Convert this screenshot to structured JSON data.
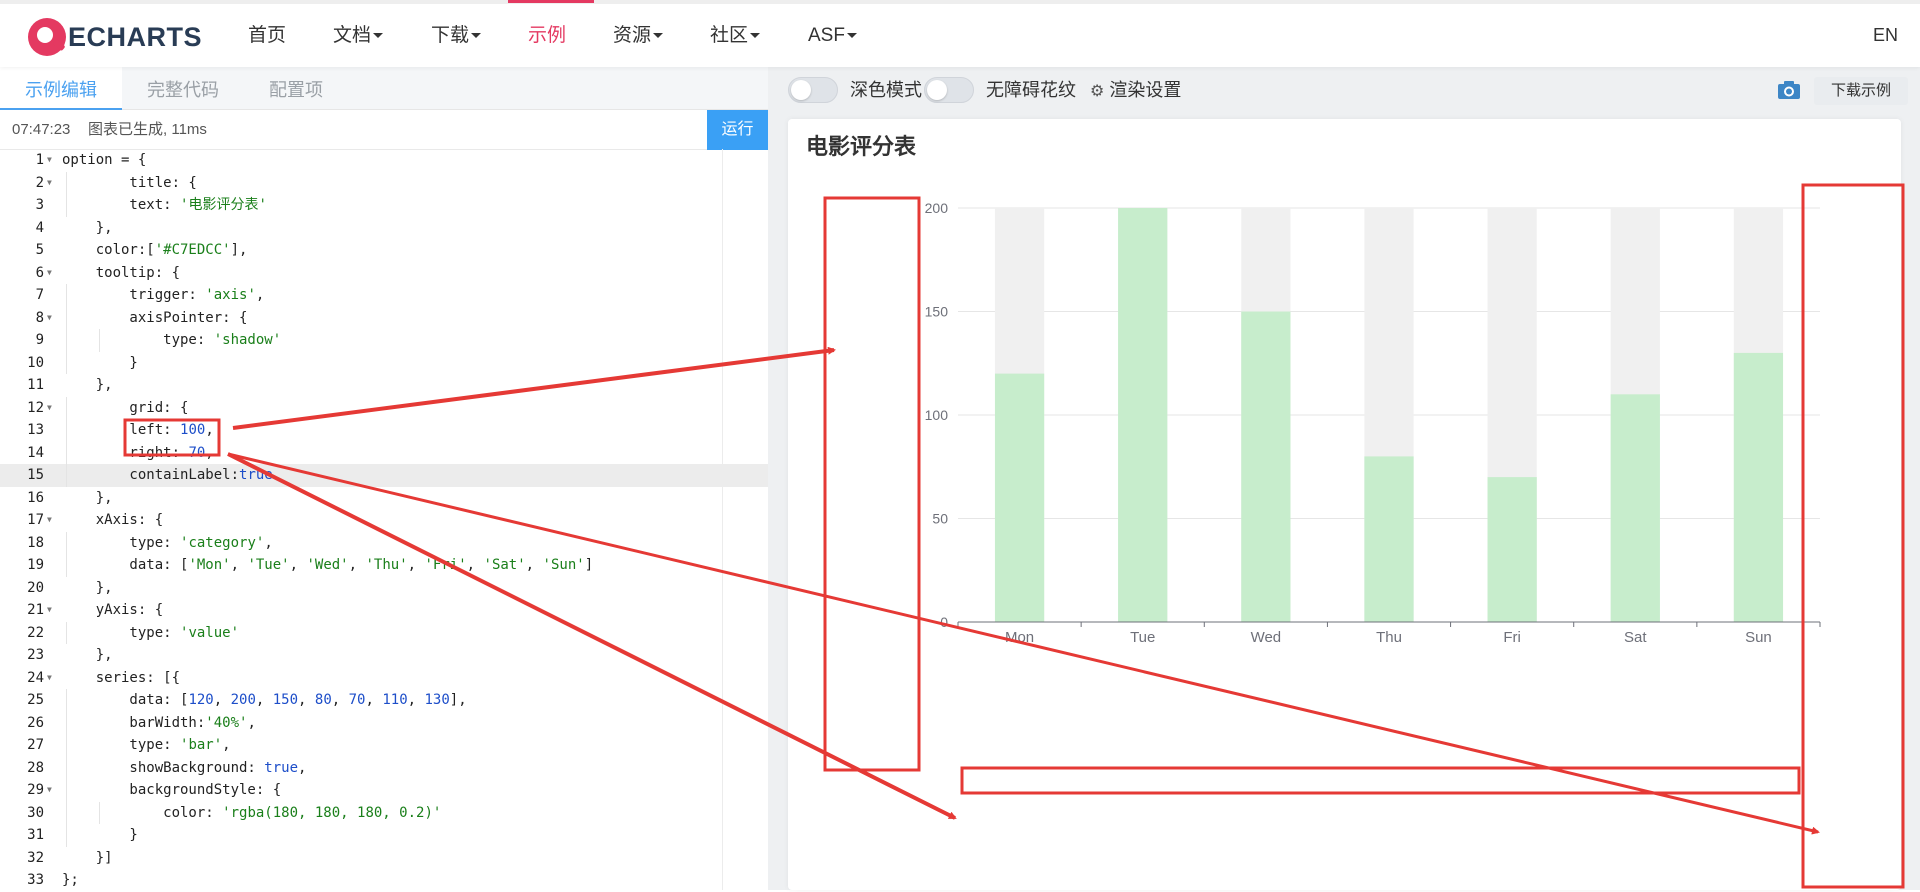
{
  "nav": {
    "logo_text": "ECHARTS",
    "items": [
      {
        "label": "首页",
        "has_caret": false,
        "active": false
      },
      {
        "label": "文档",
        "has_caret": true,
        "active": false
      },
      {
        "label": "下载",
        "has_caret": true,
        "active": false
      },
      {
        "label": "示例",
        "has_caret": false,
        "active": true
      },
      {
        "label": "资源",
        "has_caret": true,
        "active": false
      },
      {
        "label": "社区",
        "has_caret": true,
        "active": false
      },
      {
        "label": "ASF",
        "has_caret": true,
        "active": false
      }
    ],
    "lang": "EN",
    "accent_color": "#e43961"
  },
  "editor": {
    "tabs": [
      {
        "label": "示例编辑",
        "active": true
      },
      {
        "label": "完整代码",
        "active": false
      },
      {
        "label": "配置项",
        "active": false
      }
    ],
    "status_time": "07:47:23",
    "status_msg": "图表已生成, 11ms",
    "run_label": "运行",
    "code_lines": [
      "option = {",
      "        title: {",
      "        text: '电影评分表'",
      "    },",
      "    color:['#C7EDCC'],",
      "    tooltip: {",
      "        trigger: 'axis',",
      "        axisPointer: {",
      "            type: 'shadow'",
      "        }",
      "    },",
      "        grid: {",
      "        left: 100,",
      "        right: 70,",
      "        containLabel:true",
      "    },",
      "    xAxis: {",
      "        type: 'category',",
      "        data: ['Mon', 'Tue', 'Wed', 'Thu', 'Fri', 'Sat', 'Sun']",
      "    },",
      "    yAxis: {",
      "        type: 'value'",
      "    },",
      "    series: [{",
      "        data: [120, 200, 150, 80, 70, 110, 130],",
      "        barWidth:'40%',",
      "        type: 'bar',",
      "        showBackground: true,",
      "        backgroundStyle: {",
      "            color: 'rgba(180, 180, 180, 0.2)'",
      "        }",
      "    }]",
      "};"
    ],
    "fold_lines": [
      1,
      2,
      6,
      8,
      12,
      17,
      21,
      24,
      29
    ],
    "highlight_line": 15
  },
  "preview": {
    "dark_mode_label": "深色模式",
    "accessibility_label": "无障碍花纹",
    "render_settings_label": "渲染设置",
    "download_label": "下载示例"
  },
  "chart_data": {
    "type": "bar",
    "title": "电影评分表",
    "categories": [
      "Mon",
      "Tue",
      "Wed",
      "Thu",
      "Fri",
      "Sat",
      "Sun"
    ],
    "values": [
      120,
      200,
      150,
      80,
      70,
      110,
      130
    ],
    "ylim": [
      0,
      200
    ],
    "yticks": [
      0,
      50,
      100,
      150,
      200
    ],
    "bar_color": "#C7EDCC",
    "background_color": "#f0f0f0",
    "grid": true,
    "annotation_color": "#e53935"
  }
}
